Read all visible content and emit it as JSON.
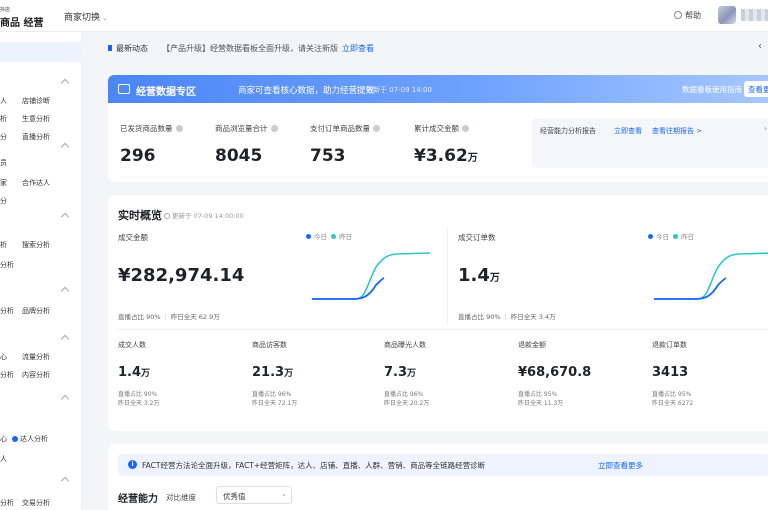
{
  "topbar": {
    "logo_small": "抖店",
    "logo_main": "商品 经营",
    "shop_switch": "商家切换",
    "help": "帮助",
    "chevron": "⌄"
  },
  "sidebar": {
    "items": [
      {
        "label": "人"
      },
      {
        "label": "店铺诊断"
      },
      {
        "label": "析"
      },
      {
        "label": "生意分析"
      },
      {
        "label": "分"
      },
      {
        "label": "直播分析"
      },
      {
        "label": "员"
      },
      {
        "label": "家"
      },
      {
        "label": "合作达人"
      },
      {
        "label": "分"
      },
      {
        "label": "析"
      },
      {
        "label": "搜索分析"
      },
      {
        "label": "分析"
      },
      {
        "label": "分析"
      },
      {
        "label": "品牌分析"
      },
      {
        "label": "心"
      },
      {
        "label": "流量分析"
      },
      {
        "label": "分析"
      },
      {
        "label": "内容分析"
      },
      {
        "label": "心"
      },
      {
        "label": "达人分析"
      },
      {
        "label": "人"
      },
      {
        "label": "分析"
      },
      {
        "label": "交易分析"
      }
    ]
  },
  "breadcrumb": {
    "title": "最新动态",
    "tip": "【产品升级】经营数据看板全面升级，请关注新版",
    "link": "立即查看",
    "right": "‹"
  },
  "banner": {
    "title": "经营数据专区",
    "desc": "商家可查看核心数据，助力经营提效",
    "update": "更新于 07-09 14:00",
    "right_link": "数据看板使用指南",
    "right_btn": "查看更多"
  },
  "kpis": [
    {
      "label": "已发货商品数量",
      "value": "296",
      "unit": ""
    },
    {
      "label": "商品浏览量合计",
      "value": "8045",
      "unit": ""
    },
    {
      "label": "支付订单商品数量",
      "value": "753",
      "unit": ""
    },
    {
      "label": "累计成交金额",
      "value": "¥3.62",
      "unit": "万"
    }
  ],
  "right_box": {
    "text": "经营能力分析报告",
    "link1": "立即查看",
    "link2": "查看往期报告 >",
    "chevron": "›"
  },
  "realtime": {
    "title": "实时概览",
    "update": "更新于 07-09 14:00:00",
    "legend_today": "今日",
    "legend_yesterday": "昨日",
    "color_today": "#1966ff",
    "color_yesterday": "#2ec7c9",
    "gmv": {
      "label": "成交金额",
      "value": "¥282,974.14",
      "unit": "",
      "sub1": "直播占比 90%",
      "sub2": "昨日全天 62.9万"
    },
    "orders": {
      "label": "成交订单数",
      "value": "1.4",
      "unit": "万",
      "sub1": "直播占比 90%",
      "sub2": "昨日全天 3.4万"
    }
  },
  "metrics": [
    {
      "label": "成交人数",
      "value": "1.4",
      "unit": "万",
      "sub1": "直播占比 90%",
      "sub2": "昨日全天 3.2万"
    },
    {
      "label": "商品访客数",
      "value": "21.3",
      "unit": "万",
      "sub1": "直播占比 96%",
      "sub2": "昨日全天 72.1万"
    },
    {
      "label": "商品曝光人数",
      "value": "7.3",
      "unit": "万",
      "sub1": "直播占比 96%",
      "sub2": "昨日全天 20.2万"
    },
    {
      "label": "退款金额",
      "value": "¥68,670.8",
      "unit": "",
      "sub1": "直播占比 95%",
      "sub2": "昨日全天 11.3万"
    },
    {
      "label": "退款订单数",
      "value": "3413",
      "unit": "",
      "sub1": "直播占比 95%",
      "sub2": "昨日全天 6272"
    }
  ],
  "notice": {
    "icon": "i",
    "text": "FACT经营方法论全面升级，FACT+经营矩阵，达人、店铺、直播、人群、营销、商品等全链路经营诊断",
    "link": "立即查看更多"
  },
  "ops": {
    "title": "经营能力",
    "compare": "对比维度",
    "select": "优秀值",
    "chevron": "⌄"
  }
}
